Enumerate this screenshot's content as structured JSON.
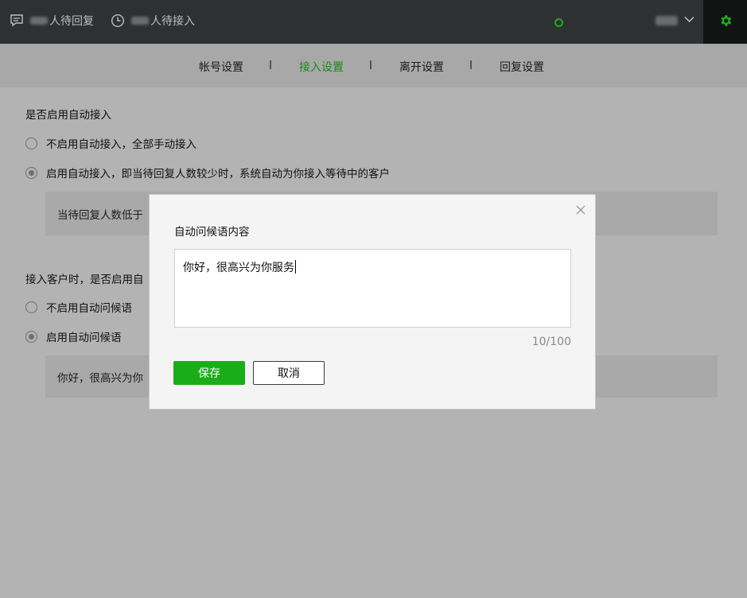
{
  "topbar": {
    "pending_reply_label": "人待回复",
    "pending_access_label": "人待接入",
    "status_color": "#19ad19",
    "chat_icon": "chat-bubble-icon",
    "clock_icon": "clock-icon",
    "settings_icon": "gear-icon"
  },
  "tabs": [
    {
      "label": "帐号设置"
    },
    {
      "label": "接入设置",
      "active": true
    },
    {
      "label": "离开设置"
    },
    {
      "label": "回复设置"
    }
  ],
  "auto_access": {
    "title": "是否启用自动接入",
    "options": [
      {
        "label": "不启用自动接入，全部手动接入",
        "checked": false
      },
      {
        "label": "启用自动接入，即当待回复人数较少时，系统自动为你接入等待中的客户",
        "checked": true
      }
    ],
    "panel_text": "当待回复人数低于"
  },
  "auto_greeting": {
    "title": "接入客户时，是否启用自",
    "options": [
      {
        "label": "不启用自动问候语",
        "checked": false
      },
      {
        "label": "启用自动问候语",
        "checked": true
      }
    ],
    "panel_text": "你好，很高兴为你"
  },
  "modal": {
    "title": "自动问候语内容",
    "content": "你好，很高兴为你服务",
    "counter": "10/100",
    "save_label": "保存",
    "cancel_label": "取消",
    "accent_color": "#1aad19"
  }
}
